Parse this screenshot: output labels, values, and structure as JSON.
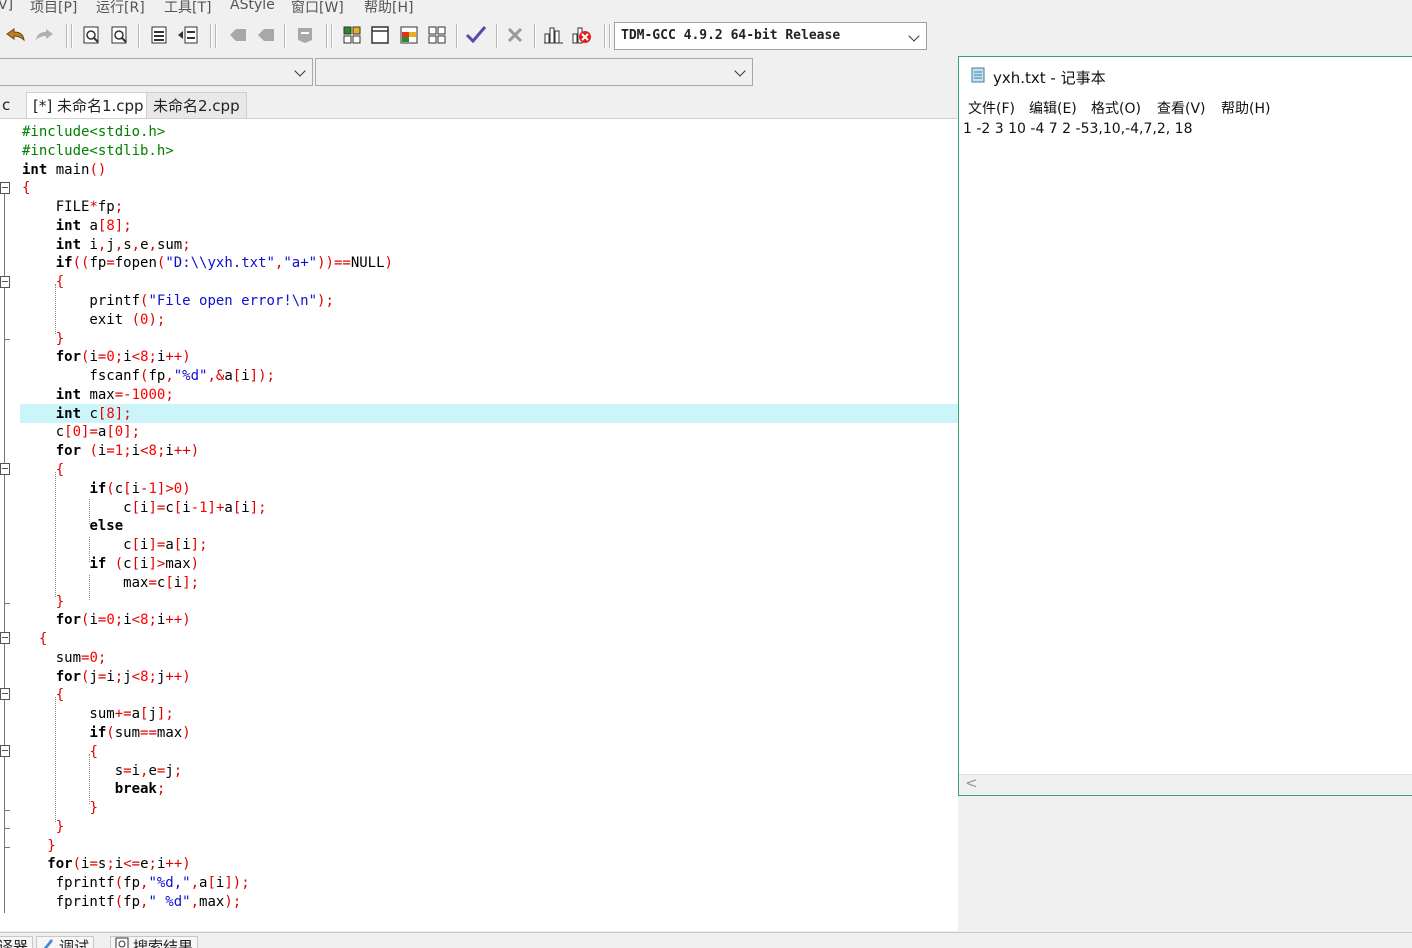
{
  "menu": {
    "items": [
      "V]",
      "项目[P]",
      "运行[R]",
      "工具[T]",
      "AStyle",
      "窗口[W]",
      "帮助[H]"
    ]
  },
  "toolbar": {
    "compiler": "TDM-GCC 4.9.2 64-bit Release"
  },
  "tabs": {
    "partial": "c",
    "items": [
      "[*] 未命名1.cpp",
      "未命名2.cpp"
    ]
  },
  "code_lines": [
    "#include<stdio.h>",
    "#include<stdlib.h>",
    "int main()",
    "{",
    "    FILE*fp;",
    "    int a[8];",
    "    int i,j,s,e,sum;",
    "    if((fp=fopen(\"D:\\\\yxh.txt\",\"a+\"))==NULL)",
    "    {",
    "        printf(\"File open error!\\n\");",
    "        exit (0);",
    "    }",
    "    for(i=0;i<8;i++)",
    "        fscanf(fp,\"%d\",&a[i]);",
    "    int max=-1000;",
    "    int c[8];",
    "    c[0]=a[0];",
    "    for (i=1;i<8;i++)",
    "    {",
    "        if(c[i-1]>0)",
    "            c[i]=c[i-1]+a[i];",
    "        else",
    "            c[i]=a[i];",
    "        if (c[i]>max)",
    "            max=c[i];",
    "    }",
    "    for(i=0;i<8;i++)",
    "  {",
    "    sum=0;",
    "    for(j=i;j<8;j++)",
    "    {",
    "        sum+=a[j];",
    "        if(sum==max)",
    "        {",
    "           s=i,e=j;",
    "           break;",
    "        }",
    "    }",
    "   }",
    "   for(i=s;i<=e;i++)",
    "    fprintf(fp,\"%d,\",a[i]);",
    "    fprintf(fp,\" %d\",max);"
  ],
  "notepad": {
    "title": "yxh.txt - 记事本",
    "menu": [
      "文件(F)",
      "编辑(E)",
      "格式(O)",
      "查看(V)",
      "帮助(H)"
    ],
    "content": "1 -2 3 10 -4 7 2 -53,10,-4,7,2, 18",
    "scroll_left": "<"
  },
  "bottom_tabs": [
    "编译器",
    "调试",
    "搜索结果"
  ],
  "colors": {
    "keyword": "#000000",
    "preprocessor": "#008000",
    "number": "#ff0000",
    "string": "#1010d0",
    "highlight": "#ccf5fa",
    "notepad_border": "#3aa46e"
  }
}
